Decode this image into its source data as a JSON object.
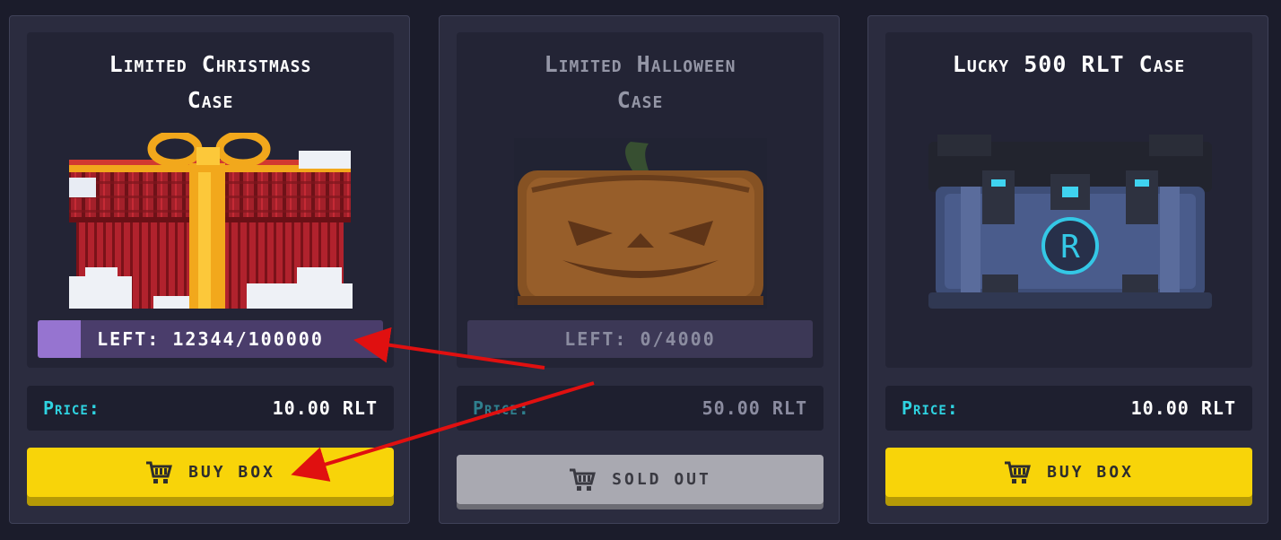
{
  "cards": [
    {
      "title_line1": "Limited Christmass",
      "title_line2": "Case",
      "left_label": "LEFT: 12344/100000",
      "left_fraction": 0.12344,
      "price_label": "Price:",
      "price": "10.00 RLT",
      "button_label": "BUY BOX",
      "button_icon": "cart-icon",
      "state": "available"
    },
    {
      "title_line1": "Limited Halloween",
      "title_line2": "Case",
      "left_label": "LEFT: 0/4000",
      "left_fraction": 0,
      "price_label": "Price:",
      "price": "50.00 RLT",
      "button_label": "SOLD OUT",
      "button_icon": "cart-icon",
      "state": "sold-out"
    },
    {
      "title_line1": "Lucky 500 RLT Case",
      "title_line2": "",
      "price_label": "Price:",
      "price": "10.00 RLT",
      "button_label": "BUY BOX",
      "button_icon": "cart-icon",
      "state": "available"
    }
  ],
  "colors": {
    "background": "#1b1c2b",
    "card": "#2b2c3f",
    "accent_yellow": "#f8d409",
    "price_label": "#2fd3e1",
    "progress_fill": "#9674d0",
    "annotation_arrow": "#e01010"
  }
}
